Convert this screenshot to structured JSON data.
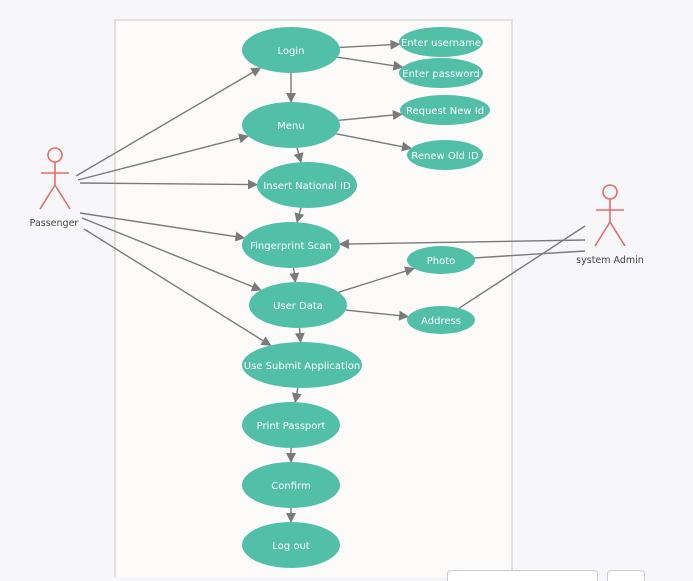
{
  "diagram": {
    "type": "use-case",
    "colors": {
      "usecase_fill": "#52c0a9",
      "actor_stroke": "#e86a6a",
      "edge": "#7a7a7a",
      "boundary_fill": "#fcfbfa",
      "boundary_stroke": "#d8d8d8"
    },
    "actors": [
      {
        "id": "passenger",
        "label": "Passenger"
      },
      {
        "id": "admin",
        "label": "system Admin"
      }
    ],
    "use_cases": [
      {
        "id": "login",
        "label": "Login"
      },
      {
        "id": "user",
        "label": "Enter username"
      },
      {
        "id": "pass",
        "label": "Enter password"
      },
      {
        "id": "menu",
        "label": "Menu"
      },
      {
        "id": "reqid",
        "label": "Request New Id"
      },
      {
        "id": "renew",
        "label": "Renew Old ID"
      },
      {
        "id": "nid",
        "label": "Insert National ID"
      },
      {
        "id": "finger",
        "label": "Fingerprint Scan"
      },
      {
        "id": "photo",
        "label": "Photo"
      },
      {
        "id": "udata",
        "label": "User Data"
      },
      {
        "id": "addr",
        "label": "Address"
      },
      {
        "id": "submit",
        "label": "Use Submit Application"
      },
      {
        "id": "print",
        "label": "Print Passport"
      },
      {
        "id": "confirm",
        "label": "Confirm"
      },
      {
        "id": "logout",
        "label": "Log out"
      }
    ],
    "edges": [
      {
        "from": "passenger",
        "to": "login",
        "arrow": true
      },
      {
        "from": "passenger",
        "to": "menu",
        "arrow": true
      },
      {
        "from": "passenger",
        "to": "nid",
        "arrow": true
      },
      {
        "from": "passenger",
        "to": "finger",
        "arrow": true
      },
      {
        "from": "passenger",
        "to": "udata",
        "arrow": true
      },
      {
        "from": "passenger",
        "to": "submit",
        "arrow": true
      },
      {
        "from": "login",
        "to": "user",
        "arrow": true
      },
      {
        "from": "login",
        "to": "pass",
        "arrow": true
      },
      {
        "from": "login",
        "to": "menu",
        "arrow": true
      },
      {
        "from": "menu",
        "to": "reqid",
        "arrow": true
      },
      {
        "from": "menu",
        "to": "renew",
        "arrow": true
      },
      {
        "from": "menu",
        "to": "nid",
        "arrow": true
      },
      {
        "from": "nid",
        "to": "finger",
        "arrow": true
      },
      {
        "from": "finger",
        "to": "udata",
        "arrow": true
      },
      {
        "from": "udata",
        "to": "photo",
        "arrow": true
      },
      {
        "from": "udata",
        "to": "addr",
        "arrow": true
      },
      {
        "from": "udata",
        "to": "submit",
        "arrow": true
      },
      {
        "from": "submit",
        "to": "print",
        "arrow": true
      },
      {
        "from": "print",
        "to": "confirm",
        "arrow": true
      },
      {
        "from": "confirm",
        "to": "logout",
        "arrow": true
      },
      {
        "from": "admin",
        "to": "finger",
        "arrow": true
      },
      {
        "from": "admin",
        "to": "photo",
        "arrow": false
      },
      {
        "from": "admin",
        "to": "addr",
        "arrow": false
      }
    ]
  }
}
